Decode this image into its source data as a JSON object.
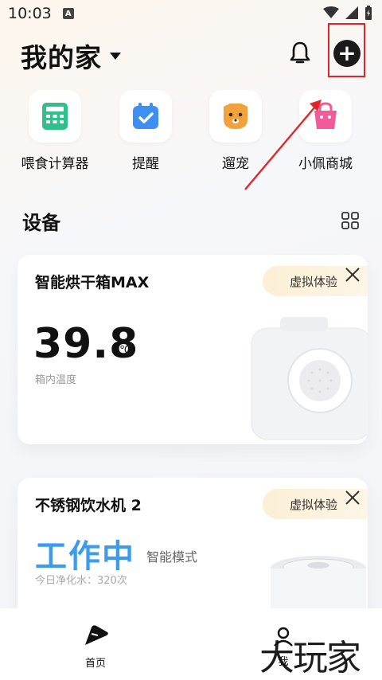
{
  "status_bar": {
    "time": "10:03",
    "badge": "A"
  },
  "header": {
    "title": "我的家"
  },
  "quick_actions": [
    {
      "label": "喂食计算器",
      "icon": "calculator-icon",
      "color": "#31c08c"
    },
    {
      "label": "提醒",
      "icon": "calendar-check-icon",
      "color": "#3d8ff2"
    },
    {
      "label": "遛宠",
      "icon": "dog-face-icon",
      "color": "#f2a23a"
    },
    {
      "label": "小佩商城",
      "icon": "shopping-bag-icon",
      "color": "#f15b9a"
    }
  ],
  "devices_section": {
    "title": "设备"
  },
  "devices": [
    {
      "name": "智能烘干箱MAX",
      "badge": "虚拟体验",
      "temperature": "39.8",
      "unit": "℃",
      "temp_label": "箱内温度"
    },
    {
      "name": "不锈钢饮水机 2",
      "badge": "虚拟体验",
      "status": "工作中",
      "mode": "智能模式",
      "filter_text": "今日净化水：320次"
    }
  ],
  "bottom_nav": {
    "home": "首页",
    "me": "我"
  },
  "watermark": "大玩家",
  "colors": {
    "accent_blue": "#3d9be9",
    "highlight_red": "#e0262a"
  }
}
